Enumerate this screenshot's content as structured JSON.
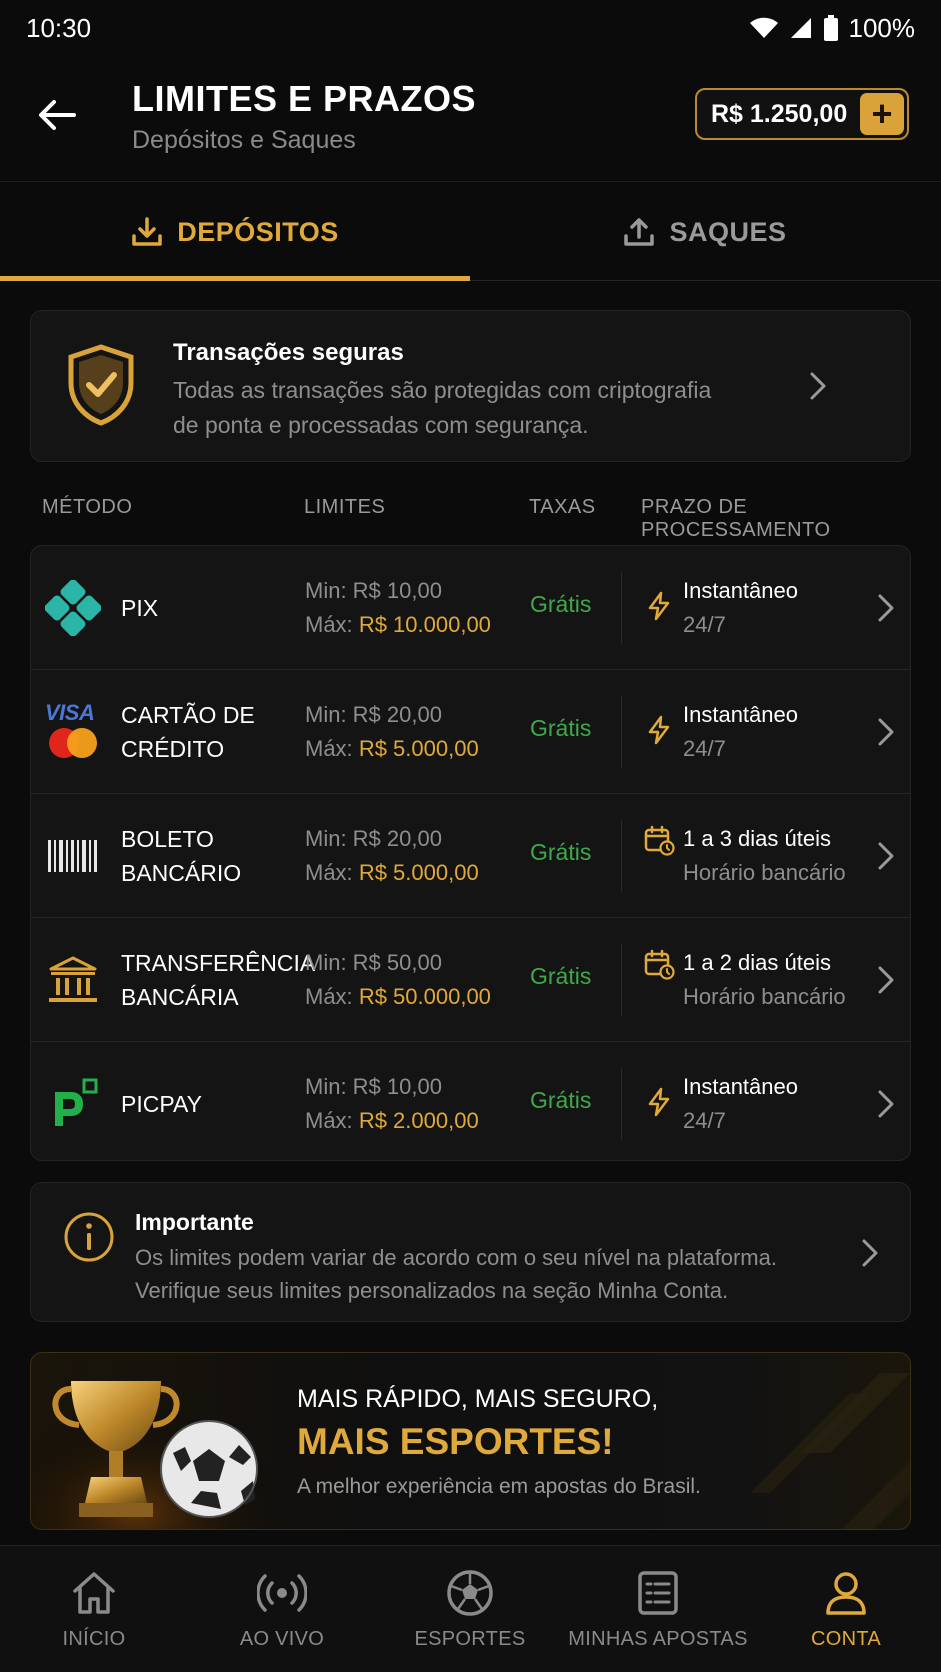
{
  "status_bar": {
    "time": "10:30",
    "battery": "100%"
  },
  "header": {
    "title": "LIMITES E PRAZOS",
    "subtitle": "Depósitos e Saques",
    "balance": "R$ 1.250,00",
    "add_label": "+"
  },
  "tabs": [
    {
      "label": "DEPÓSITOS",
      "active": true,
      "icon": "download-icon"
    },
    {
      "label": "SAQUES",
      "active": false,
      "icon": "upload-icon"
    }
  ],
  "secure": {
    "title": "Transações seguras",
    "text": "Todas as transações são protegidas com criptografia de ponta e processadas com segurança."
  },
  "columns": {
    "method": "MÉTODO",
    "limits": "LIMITES",
    "fees": "TAXAS",
    "time": "PRAZO DE PROCESSAMENTO"
  },
  "methods": [
    {
      "name1": "PIX",
      "name2": "",
      "min": "Min: R$ 10,00",
      "max_label": "Máx:",
      "max_value": "R$ 10.000,00",
      "fee": "Grátis",
      "time1": "Instantâneo",
      "time2": "24/7",
      "icon": "pix-icon",
      "time_icon": "lightning-icon"
    },
    {
      "name1": "CARTÃO DE",
      "name2": "CRÉDITO",
      "min": "Min: R$ 20,00",
      "max_label": "Máx:",
      "max_value": "R$ 5.000,00",
      "fee": "Grátis",
      "time1": "Instantâneo",
      "time2": "24/7",
      "icon": "credit-card-icon",
      "visa": "VISA",
      "time_icon": "lightning-icon"
    },
    {
      "name1": "BOLETO",
      "name2": "BANCÁRIO",
      "min": "Min: R$ 20,00",
      "max_label": "Máx:",
      "max_value": "R$ 5.000,00",
      "fee": "Grátis",
      "time1": "1 a 3 dias úteis",
      "time2": "Horário bancário",
      "icon": "barcode-icon",
      "time_icon": "calendar-clock-icon"
    },
    {
      "name1": "TRANSFERÊNCIA",
      "name2": "BANCÁRIA",
      "min": "Min: R$ 50,00",
      "max_label": "Máx:",
      "max_value": "R$ 50.000,00",
      "fee": "Grátis",
      "time1": "1 a 2 dias úteis",
      "time2": "Horário bancário",
      "icon": "bank-icon",
      "time_icon": "calendar-clock-icon"
    },
    {
      "name1": "PICPAY",
      "name2": "",
      "min": "Min: R$ 10,00",
      "max_label": "Máx:",
      "max_value": "R$ 2.000,00",
      "fee": "Grátis",
      "time1": "Instantâneo",
      "time2": "24/7",
      "icon": "picpay-icon",
      "time_icon": "lightning-icon"
    }
  ],
  "important": {
    "title": "Importante",
    "text": "Os limites podem variar de acordo com o seu nível na plataforma. Verifique seus limites personalizados na seção Minha Conta."
  },
  "promo": {
    "line1": "MAIS RÁPIDO, MAIS SEGURO,",
    "line2": "MAIS ESPORTES!",
    "line3": "A melhor experiência em apostas do Brasil."
  },
  "nav": [
    {
      "label": "INÍCIO",
      "icon": "home-icon",
      "active": false
    },
    {
      "label": "AO VIVO",
      "icon": "live-icon",
      "active": false
    },
    {
      "label": "ESPORTES",
      "icon": "soccer-ball-icon",
      "active": false
    },
    {
      "label": "MINHAS APOSTAS",
      "icon": "bets-list-icon",
      "active": false
    },
    {
      "label": "CONTA",
      "icon": "user-icon",
      "active": true
    }
  ],
  "colors": {
    "accent": "#e0a93b",
    "fee_green": "#3fa94a",
    "background": "#0b0b0b",
    "card": "#141414"
  }
}
